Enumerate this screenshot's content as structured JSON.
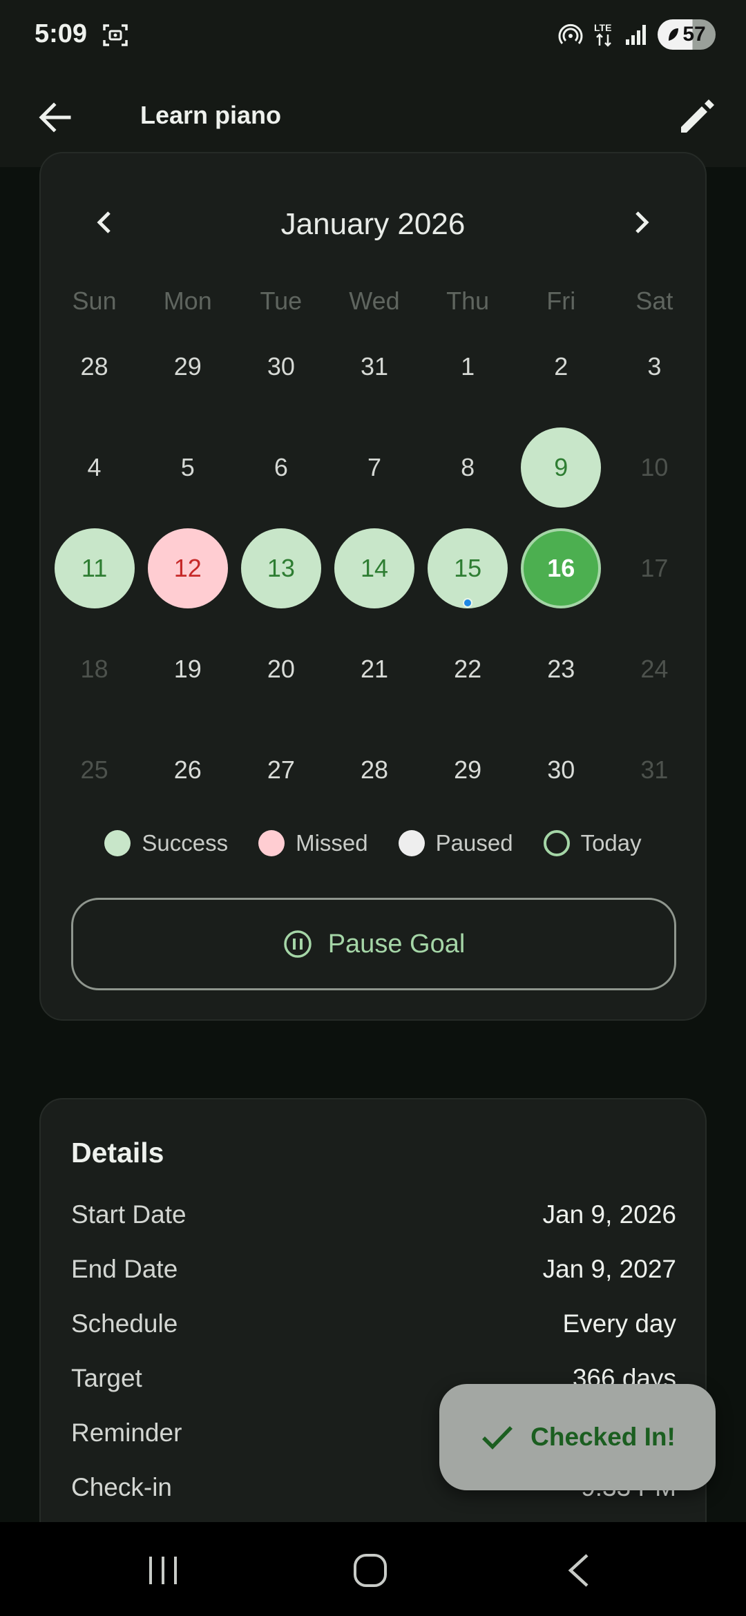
{
  "status_bar": {
    "time": "5:09",
    "battery": "57",
    "network": "LTE"
  },
  "app_bar": {
    "title": "Learn piano"
  },
  "calendar": {
    "month_label": "January 2026",
    "weekdays": [
      "Sun",
      "Mon",
      "Tue",
      "Wed",
      "Thu",
      "Fri",
      "Sat"
    ],
    "days": [
      {
        "n": "28",
        "s": "out"
      },
      {
        "n": "29",
        "s": "out"
      },
      {
        "n": "30",
        "s": "out"
      },
      {
        "n": "31",
        "s": "out"
      },
      {
        "n": "1",
        "s": "out"
      },
      {
        "n": "2",
        "s": "out"
      },
      {
        "n": "3",
        "s": "out"
      },
      {
        "n": "4",
        "s": "out"
      },
      {
        "n": "5",
        "s": "out"
      },
      {
        "n": "6",
        "s": "out"
      },
      {
        "n": "7",
        "s": "out"
      },
      {
        "n": "8",
        "s": "out"
      },
      {
        "n": "9",
        "s": "success"
      },
      {
        "n": "10",
        "s": "weekend-future"
      },
      {
        "n": "11",
        "s": "success"
      },
      {
        "n": "12",
        "s": "missed"
      },
      {
        "n": "13",
        "s": "success"
      },
      {
        "n": "14",
        "s": "success"
      },
      {
        "n": "15",
        "s": "success",
        "dot": true
      },
      {
        "n": "16",
        "s": "today"
      },
      {
        "n": "17",
        "s": "weekend-future"
      },
      {
        "n": "18",
        "s": "weekend-future"
      },
      {
        "n": "19",
        "s": "cur"
      },
      {
        "n": "20",
        "s": "cur"
      },
      {
        "n": "21",
        "s": "cur"
      },
      {
        "n": "22",
        "s": "cur"
      },
      {
        "n": "23",
        "s": "cur"
      },
      {
        "n": "24",
        "s": "weekend-future"
      },
      {
        "n": "25",
        "s": "weekend-future"
      },
      {
        "n": "26",
        "s": "cur"
      },
      {
        "n": "27",
        "s": "cur"
      },
      {
        "n": "28",
        "s": "cur"
      },
      {
        "n": "29",
        "s": "cur"
      },
      {
        "n": "30",
        "s": "cur"
      },
      {
        "n": "31",
        "s": "weekend-future"
      }
    ],
    "legend": {
      "success": "Success",
      "missed": "Missed",
      "paused": "Paused",
      "today": "Today"
    },
    "pause_button_label": "Pause Goal"
  },
  "details": {
    "title": "Details",
    "start_date": {
      "label": "Start Date",
      "value": "Jan 9, 2026"
    },
    "end_date": {
      "label": "End Date",
      "value": "Jan 9, 2027"
    },
    "schedule": {
      "label": "Schedule",
      "value": "Every day"
    },
    "target": {
      "label": "Target",
      "value": "366 days"
    },
    "reminder": {
      "label": "Reminder",
      "value": ""
    },
    "checkin": {
      "label": "Check-in",
      "value": "9:33 PM"
    }
  },
  "snackbar": {
    "message": "Checked In!"
  },
  "colors": {
    "success": "#c8e6c9",
    "missed": "#ffcdd2",
    "today": "#4caf50",
    "accent": "#a5d6a7"
  }
}
